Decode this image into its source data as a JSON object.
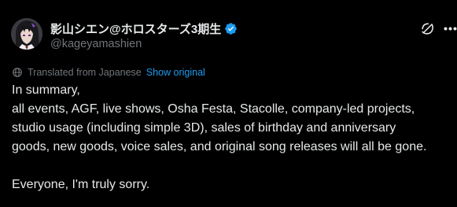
{
  "author": {
    "display_name": "影山シエン@ホロスターズ3期生",
    "handle": "@kageyamashien"
  },
  "icons": {
    "verified": "verified-badge-icon",
    "grok": "grok-icon",
    "more": "more-options-icon",
    "translate": "globe-icon"
  },
  "colors": {
    "background": "#000000",
    "text": "#e7e9ea",
    "muted": "#71767b",
    "accent": "#1d9bf0"
  },
  "translation": {
    "label": "Translated from Japanese",
    "show_original": "Show original"
  },
  "tweet": {
    "lines": [
      "In summary,",
      "all events, AGF, live shows, Osha Festa, Stacolle, company-led projects,",
      "studio usage (including simple 3D), sales of birthday and anniversary",
      "goods, new goods, voice sales, and original song releases will all be gone.",
      "",
      "Everyone, I'm truly sorry."
    ]
  }
}
